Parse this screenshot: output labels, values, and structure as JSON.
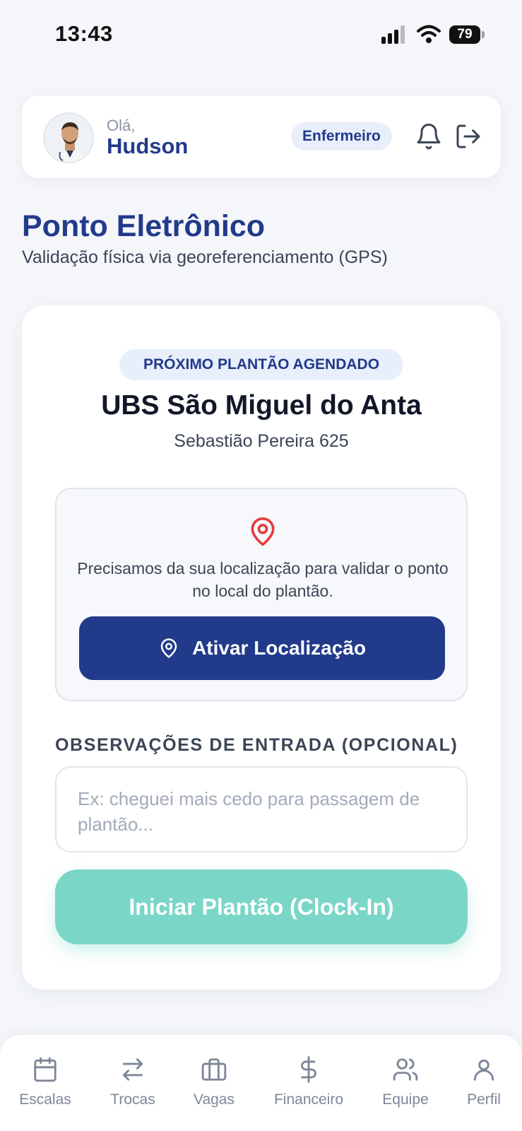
{
  "status_bar": {
    "time": "13:43",
    "battery": "79"
  },
  "header": {
    "greeting": "Olá,",
    "user_name": "Hudson",
    "role": "Enfermeiro"
  },
  "page": {
    "title": "Ponto Eletrônico",
    "subtitle": "Validação física via georeferenciamento (GPS)"
  },
  "shift": {
    "badge": "PRÓXIMO PLANTÃO AGENDADO",
    "place_name": "UBS São Miguel do Anta",
    "address": "Sebastião Pereira 625"
  },
  "location": {
    "message": "Precisamos da sua localização para validar o ponto no local do plantão.",
    "button_label": "Ativar Localização"
  },
  "observations": {
    "label": "OBSERVAÇÕES DE ENTRADA (OPCIONAL)",
    "placeholder": "Ex: cheguei mais cedo para passagem de plantão...",
    "value": ""
  },
  "clockin": {
    "button_label": "Iniciar Plantão (Clock-In)"
  },
  "bottom_nav": {
    "items": [
      {
        "label": "Escalas",
        "icon": "calendar-icon"
      },
      {
        "label": "Trocas",
        "icon": "swap-icon"
      },
      {
        "label": "Vagas",
        "icon": "briefcase-icon"
      },
      {
        "label": "Financeiro",
        "icon": "dollar-icon"
      },
      {
        "label": "Equipe",
        "icon": "team-icon"
      },
      {
        "label": "Perfil",
        "icon": "user-icon"
      }
    ]
  },
  "colors": {
    "primary": "#223a8a",
    "accent_teal": "#7ad6c7",
    "pin_red": "#e53e3e",
    "background": "#f4f6fa"
  }
}
